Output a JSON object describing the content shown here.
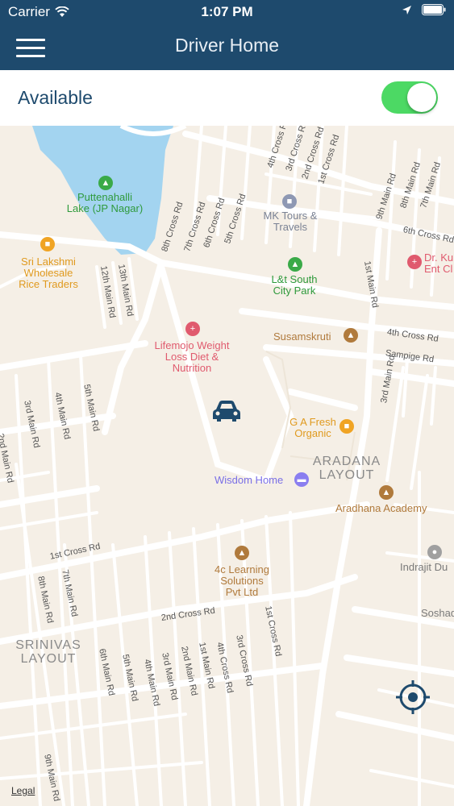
{
  "status_bar": {
    "carrier": "Carrier",
    "time": "1:07 PM"
  },
  "nav": {
    "title": "Driver Home"
  },
  "availability": {
    "label": "Available",
    "on": true,
    "toggle_color": "#4cd964"
  },
  "colors": {
    "header": "#1e4a6d",
    "map_bg": "#f5efe6",
    "water": "#a3d4f0",
    "road": "#ffffff",
    "park": "#3aaa48",
    "shop": "#f0a424",
    "medical": "#e05a6e",
    "education": "#b07a3c",
    "hotel": "#8a7ef0"
  },
  "map": {
    "pois": [
      {
        "name": "Puttenahalli\nLake (JP Nagar)",
        "icon": "tree-icon",
        "category": "park"
      },
      {
        "name": "MK Tours &\nTravels",
        "icon": "building-icon",
        "category": "business"
      },
      {
        "name": "Sri Lakshmi\nWholesale\nRice Traders",
        "icon": "shopping-bag-icon",
        "category": "shop"
      },
      {
        "name": "L&t South\nCity Park",
        "icon": "tree-icon",
        "category": "park"
      },
      {
        "name": "Dr. Ku\nEnt Cl",
        "icon": "medical-icon",
        "category": "medical"
      },
      {
        "name": "Lifemojo Weight\nLoss Diet &\nNutrition",
        "icon": "medical-icon",
        "category": "medical"
      },
      {
        "name": "Susamskruti",
        "icon": "graduation-cap-icon",
        "category": "education"
      },
      {
        "name": "G A Fresh\nOrganic",
        "icon": "shopping-bag-icon",
        "category": "shop"
      },
      {
        "name": "Wisdom Home",
        "icon": "bed-icon",
        "category": "hotel"
      },
      {
        "name": "Aradhana Academy",
        "icon": "graduation-cap-icon",
        "category": "education"
      },
      {
        "name": "Indrajit Du",
        "icon": "pin-icon",
        "category": "other"
      },
      {
        "name": "4c Learning\nSolutions\nPvt Ltd",
        "icon": "graduation-cap-icon",
        "category": "education"
      },
      {
        "name": "Soshad",
        "icon": "",
        "category": "other"
      }
    ],
    "areas": [
      "ARADANA\nLAYOUT",
      "SRINIVAS\nLAYOUT"
    ],
    "streets": [
      "4th Cross Rd",
      "3rd Cross Rd",
      "2nd Cross Rd",
      "1st Cross Rd",
      "8th Cross Rd",
      "7th Cross Rd",
      "6th Cross Rd",
      "5th Cross Rd",
      "9th Main Rd",
      "8th Main Rd",
      "7th Main Rd",
      "6th Cross Rd",
      "1st Main Rd",
      "12th Main Rd",
      "13th Main Rd",
      "4th Cross Rd",
      "Sampige Rd",
      "3rd Main Rd",
      "5th Main Rd",
      "4th Main Rd",
      "3rd Main Rd",
      "2nd Main Rd",
      "1st Cross Rd",
      "8th Main Rd",
      "7th Main Rd",
      "2nd Cross Rd",
      "1st Cross Rd",
      "6th Main Rd",
      "5th Main Rd",
      "4th Main Rd",
      "3rd Main Rd",
      "2nd Main Rd",
      "1st Main Rd",
      "4th Cross Rd",
      "3rd Cross Rd",
      "9th Main Rd"
    ],
    "legal": "Legal"
  }
}
